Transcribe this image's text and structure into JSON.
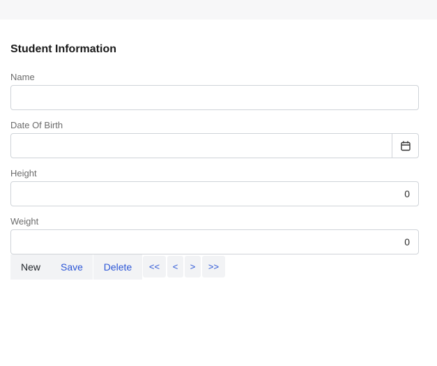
{
  "form": {
    "title": "Student Information"
  },
  "fields": {
    "name": {
      "label": "Name",
      "value": ""
    },
    "dob": {
      "label": "Date Of Birth",
      "value": "",
      "icon": "calendar-icon"
    },
    "height": {
      "label": "Height",
      "value": "0"
    },
    "weight": {
      "label": "Weight",
      "value": "0"
    }
  },
  "actions": {
    "new": "New",
    "save": "Save",
    "delete": "Delete",
    "first": "<<",
    "prev": "<",
    "next": ">",
    "last": ">>"
  },
  "colors": {
    "accent": "#2b55d6",
    "border": "#cfd3d8",
    "button_bg": "#f2f3f5"
  }
}
